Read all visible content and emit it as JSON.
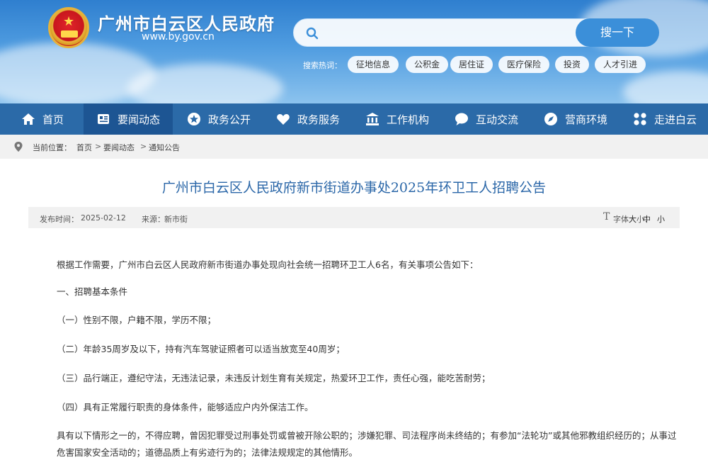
{
  "header": {
    "site_title": "广州市白云区人民政府",
    "site_url": "www.by.gov.cn"
  },
  "search": {
    "placeholder": "",
    "button_label": "搜一下",
    "hot_label": "搜索热词：",
    "hot_tags": [
      "征地信息",
      "公积金",
      "居住证",
      "医疗保险",
      "投资",
      "人才引进"
    ]
  },
  "nav": {
    "items": [
      {
        "label": "首页",
        "icon": "home-icon"
      },
      {
        "label": "要闻动态",
        "icon": "news-icon"
      },
      {
        "label": "政务公开",
        "icon": "star-icon"
      },
      {
        "label": "政务服务",
        "icon": "heart-icon"
      },
      {
        "label": "工作机构",
        "icon": "building-icon"
      },
      {
        "label": "互动交流",
        "icon": "chat-icon"
      },
      {
        "label": "营商环境",
        "icon": "compass-icon"
      },
      {
        "label": "走进白云",
        "icon": "grid-icon"
      }
    ],
    "active_index": 1
  },
  "breadcrumb": {
    "label": "当前位置：",
    "links": [
      "首页",
      "要闻动态",
      "通知公告"
    ],
    "separator": ">"
  },
  "article": {
    "title": "广州市白云区人民政府新市街道办事处2025年环卫工人招聘公告",
    "publish_time_label": "发布时间：",
    "publish_time": "2025-02-12",
    "source_label": "来源：",
    "source": "新市街",
    "font_size_label": "字体大小：",
    "font_sizes": [
      "大",
      "中",
      "小"
    ],
    "paragraphs": [
      "根据工作需要，广州市白云区人民政府新市街道办事处现向社会统一招聘环卫工人6名，有关事项公告如下：",
      "一、招聘基本条件",
      "（一）性别不限，户籍不限，学历不限；",
      "（二）年龄35周岁及以下，持有汽车驾驶证照者可以适当放宽至40周岁；",
      "（三）品行端正，遵纪守法，无违法记录，未违反计划生育有关规定，热爱环卫工作，责任心强，能吃苦耐劳；",
      "（四）具有正常履行职责的身体条件，能够适应户内外保洁工作。",
      "具有以下情形之一的，不得应聘，曾因犯罪受过刑事处罚或曾被开除公职的；涉嫌犯罪、司法程序尚未终结的；有参加“法轮功”或其他邪教组织经历的；从事过危害国家安全活动的；道德品质上有劣迹行为的；法律法规规定的其他情形。"
    ]
  },
  "colors": {
    "nav_bg": "#2b6aa8",
    "nav_active": "#1d5593",
    "title_blue": "#2b67a8",
    "search_button": "#3b8fd9"
  }
}
